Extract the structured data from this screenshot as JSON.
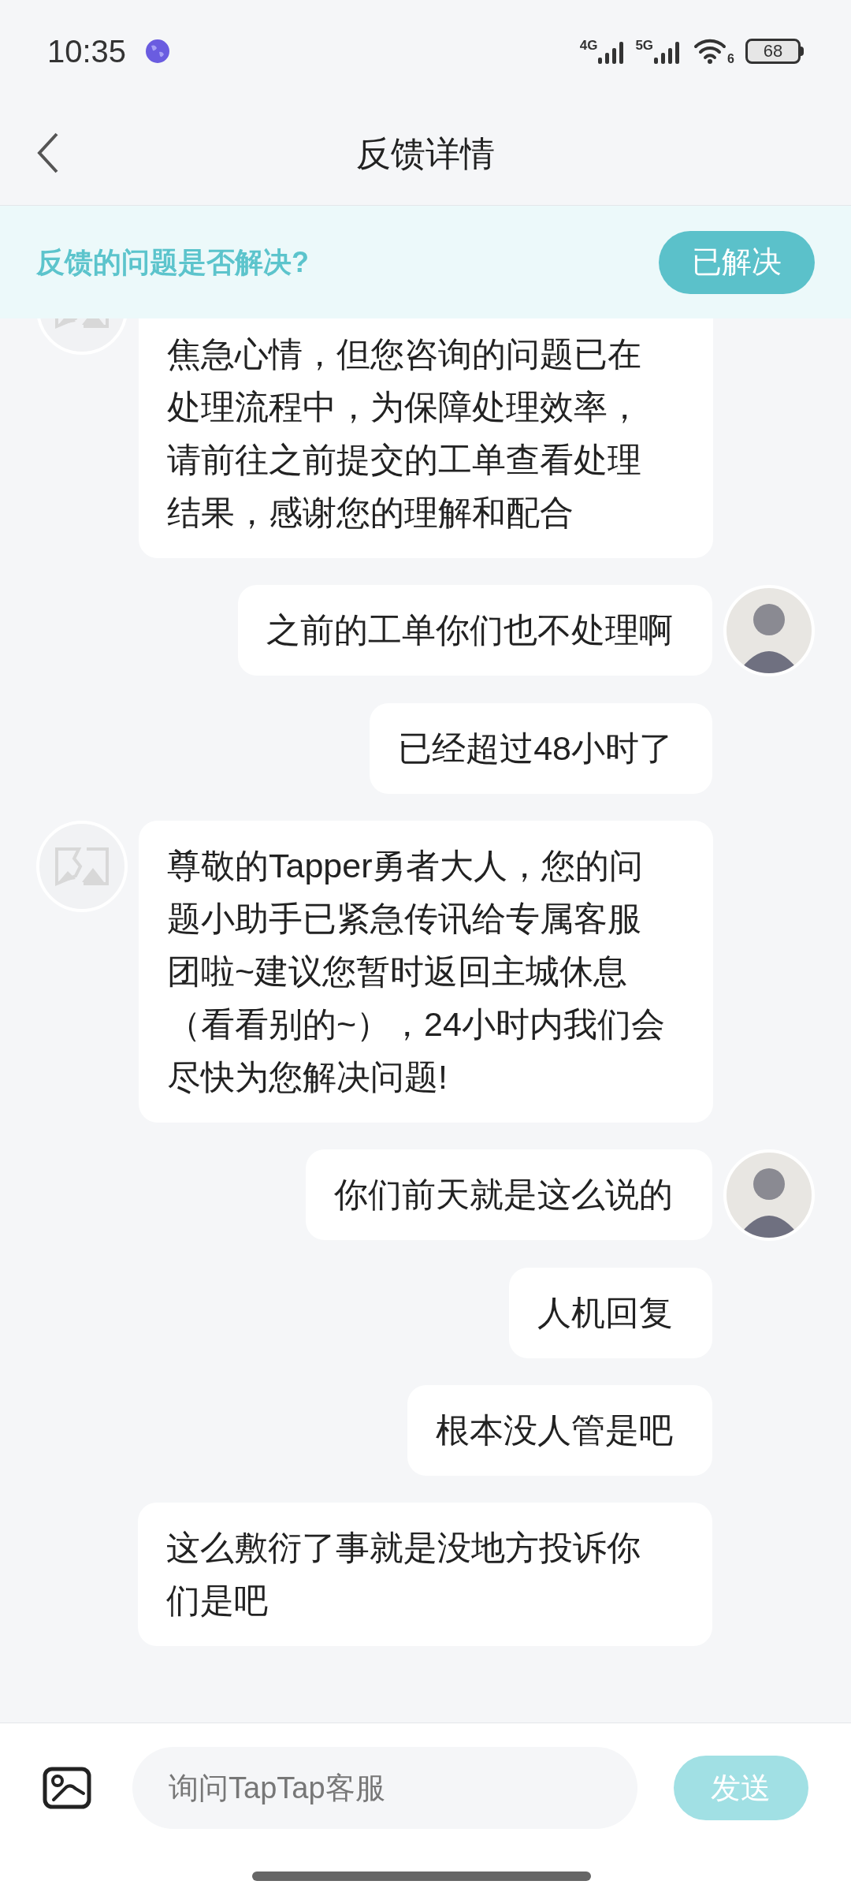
{
  "status_bar": {
    "time": "10:35",
    "signals": [
      "4G",
      "5G"
    ],
    "wifi_label": "6",
    "battery": "68"
  },
  "header": {
    "title": "反馈详情"
  },
  "banner": {
    "question": "反馈的问题是否解决?",
    "button": "已解决"
  },
  "messages": [
    {
      "kind": "agent",
      "avatar": true,
      "text": "焦急心情，但您咨询的问题已在处理流程中，为保障处理效率，请前往之前提交的工单查看处理结果，感谢您的理解和配合"
    },
    {
      "kind": "user",
      "avatar": true,
      "text": "之前的工单你们也不处理啊"
    },
    {
      "kind": "user",
      "avatar": false,
      "text": "已经超过48小时了"
    },
    {
      "kind": "agent",
      "avatar": true,
      "text": "尊敬的Tapper勇者大人，您的问题小助手已紧急传讯给专属客服团啦~建议您暂时返回主城休息（看看别的~），24小时内我们会尽快为您解决问题!"
    },
    {
      "kind": "user",
      "avatar": true,
      "text": "你们前天就是这么说的"
    },
    {
      "kind": "user",
      "avatar": false,
      "text": "人机回复"
    },
    {
      "kind": "user",
      "avatar": false,
      "text": "根本没人管是吧"
    },
    {
      "kind": "user",
      "avatar": false,
      "text": "这么敷衍了事就是没地方投诉你们是吧"
    }
  ],
  "composer": {
    "placeholder": "询问TapTap客服",
    "send": "发送",
    "send_disabled": true
  }
}
